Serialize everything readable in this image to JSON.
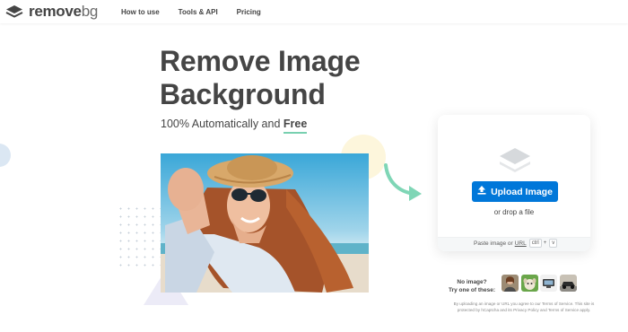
{
  "brand": {
    "logo_main": "remove",
    "logo_suffix": "bg",
    "icon": "layers-logo-icon"
  },
  "nav": {
    "items": [
      {
        "label": "How to use"
      },
      {
        "label": "Tools & API"
      },
      {
        "label": "Pricing"
      }
    ]
  },
  "hero": {
    "title_line1": "Remove Image",
    "title_line2": "Background",
    "subtitle_prefix": "100% Automatically and ",
    "subtitle_emph": "Free"
  },
  "upload": {
    "icon": "layers-icon",
    "button_icon": "upload-icon",
    "button_label": "Upload Image",
    "drop_text": "or drop a file",
    "paste_prefix": "Paste image or",
    "paste_url": "URL",
    "kbd_ctrl": "ctrl",
    "kbd_plus": "+",
    "kbd_v": "v"
  },
  "samples": {
    "prompt_line1": "No image?",
    "prompt_line2": "Try one of these:",
    "items": [
      "sample-person",
      "sample-animal",
      "sample-product",
      "sample-car"
    ]
  },
  "terms": {
    "line": "By uploading an image or URL you agree to our Terms of Service. This site is protected by hCaptcha and its Privacy Policy and Terms of Service apply."
  },
  "colors": {
    "primary": "#0077d9",
    "accent": "#78d0b0",
    "text": "#454545"
  }
}
